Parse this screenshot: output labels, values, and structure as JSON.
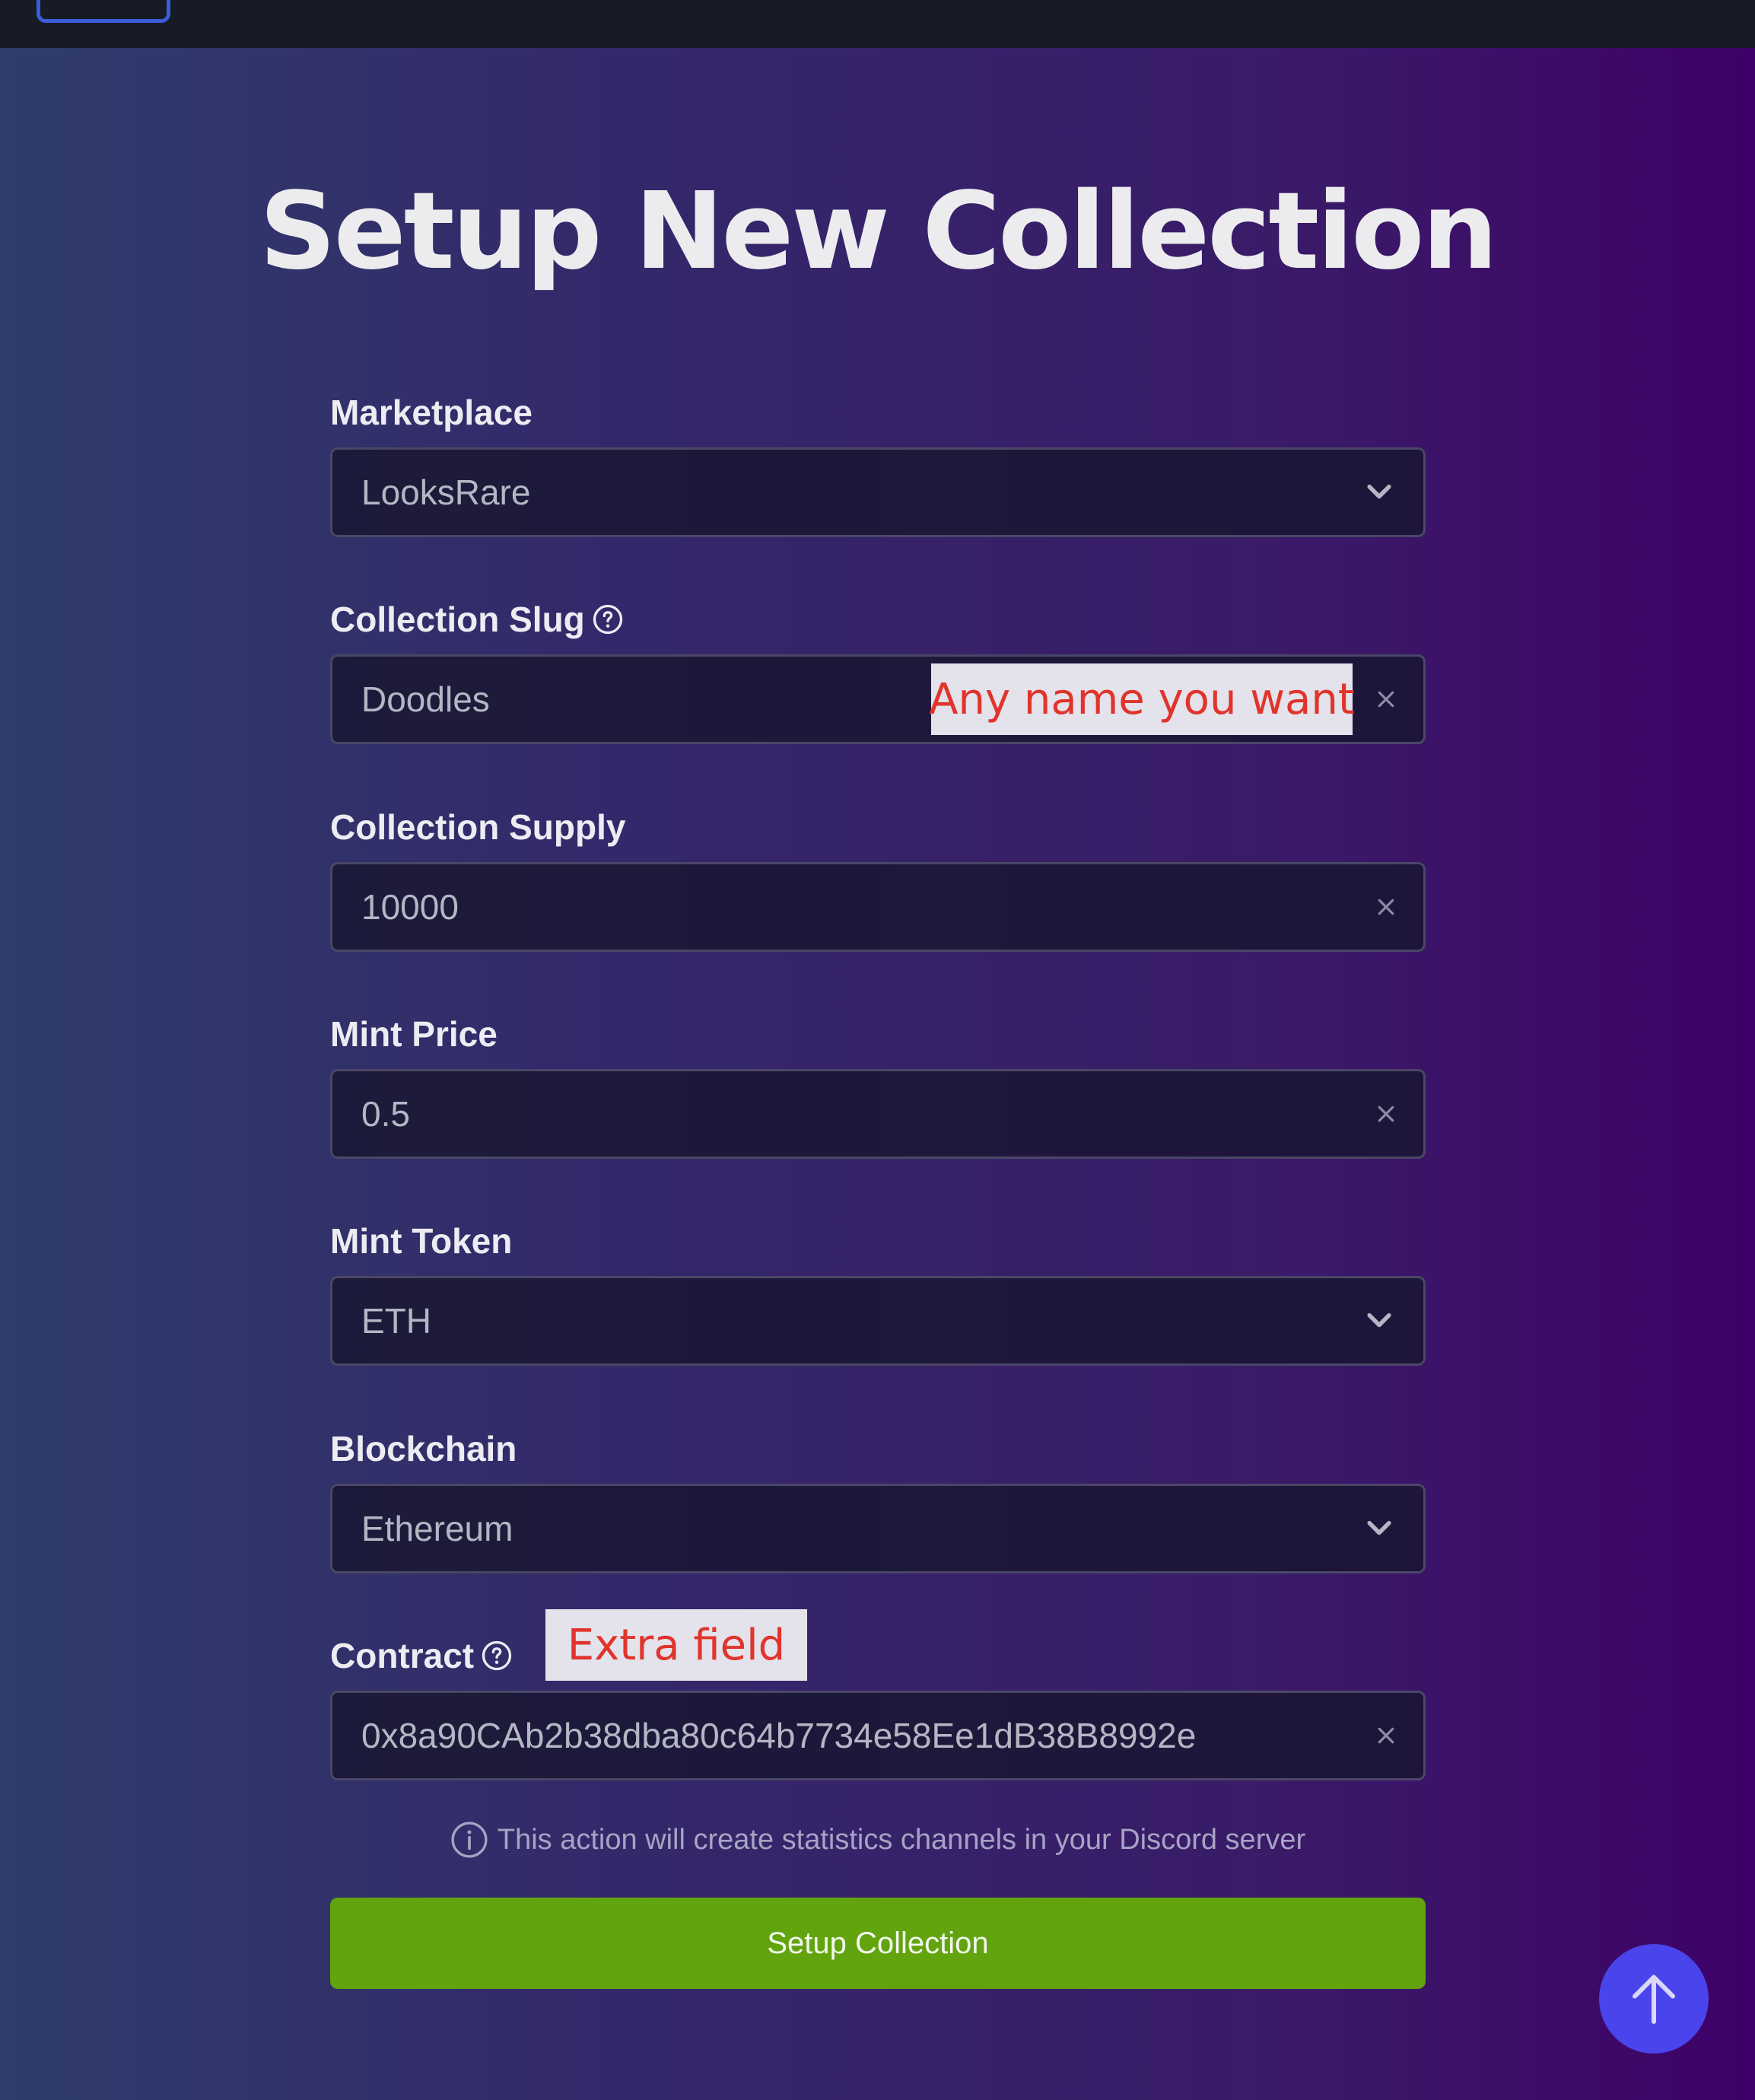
{
  "page": {
    "title": "Setup New Collection"
  },
  "fields": {
    "marketplace": {
      "label": "Marketplace",
      "value": "LooksRare"
    },
    "collection_slug": {
      "label": "Collection Slug",
      "value": "Doodles"
    },
    "collection_supply": {
      "label": "Collection Supply",
      "value": "10000"
    },
    "mint_price": {
      "label": "Mint Price",
      "value": "0.5"
    },
    "mint_token": {
      "label": "Mint Token",
      "value": "ETH"
    },
    "blockchain": {
      "label": "Blockchain",
      "value": "Ethereum"
    },
    "contract": {
      "label": "Contract",
      "value": "0x8a90CAb2b38dba80c64b7734e58Ee1dB38B8992e"
    }
  },
  "annotations": {
    "slug_note": "Any name you want",
    "contract_note": "Extra field"
  },
  "info": {
    "text": "This action will create statistics channels in your Discord server"
  },
  "actions": {
    "submit_label": "Setup Collection"
  },
  "colors": {
    "submit_bg": "#62a40d",
    "scroll_top_bg": "#4944ec",
    "annotation_text": "#e0342c",
    "topbar_accent": "#3b5bdb"
  }
}
